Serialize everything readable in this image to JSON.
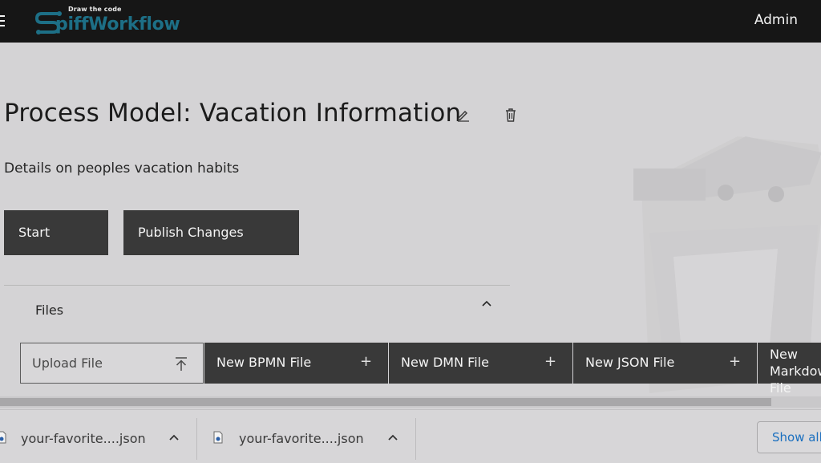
{
  "header": {
    "logo_tagline": "Draw the code",
    "logo_text": "piffWorkflow",
    "user": "Admin"
  },
  "main": {
    "title": "Process Model: Vacation Information",
    "description": "Details on peoples vacation habits",
    "buttons": {
      "start": "Start",
      "publish": "Publish Changes"
    },
    "files_section": {
      "title": "Files",
      "upload_label": "Upload File",
      "new_buttons": [
        {
          "label": "New BPMN File",
          "icon": "plus"
        },
        {
          "label": "New DMN File",
          "icon": "plus"
        },
        {
          "label": "New JSON File",
          "icon": "plus"
        },
        {
          "label": "New Markdown File",
          "icon": "plus"
        }
      ]
    }
  },
  "downloads": {
    "items": [
      {
        "name": "your-favorite....json"
      },
      {
        "name": "your-favorite....json"
      }
    ],
    "show_all": "Show all"
  },
  "colors": {
    "header_bg": "#161616",
    "logo": "#1d6f86",
    "button_bg": "#393939",
    "page_bg": "#d4d3d5",
    "link": "#1a6fbf"
  }
}
